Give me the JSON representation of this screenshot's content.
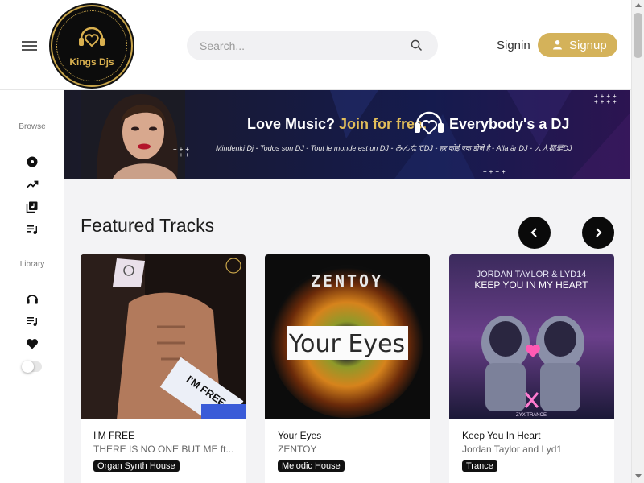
{
  "header": {
    "logo_text": "Kings Djs",
    "search_placeholder": "Search...",
    "signin_label": "Signin",
    "signup_label": "Signup"
  },
  "sidebar": {
    "browse_label": "Browse",
    "library_label": "Library",
    "browse_icons": [
      "disc-icon",
      "trending-icon",
      "library-music-icon",
      "playlist-icon"
    ],
    "library_icons": [
      "headphones-icon",
      "queue-music-icon",
      "heart-icon"
    ]
  },
  "banner": {
    "title_part1": "Love Music? ",
    "title_accent": "Join for free.",
    "title_part2": "Everybody's a DJ",
    "subtitle": "Mindenki Dj - Todos son DJ - Tout le monde est un DJ - みんなでDJ - हर कोई एक डीजे है - Alla är DJ - 人人都是DJ"
  },
  "featured": {
    "title": "Featured Tracks",
    "tracks": [
      {
        "title": "I'M FREE",
        "artist": "THERE IS NO ONE BUT ME ft...",
        "genre": "Organ Synth House",
        "art_text": "I'M FREE"
      },
      {
        "title": "Your Eyes",
        "artist": "ZENTOY",
        "genre": "Melodic House",
        "art_text": "Your Eyes",
        "art_brand": "ZENTOY"
      },
      {
        "title": "Keep You In Heart",
        "artist": "Jordan Taylor and Lyd1",
        "genre": "Trance",
        "art_line1": "JORDAN TAYLOR & LYD14",
        "art_line2": "KEEP YOU IN MY HEART",
        "art_footer": "ZYX TRANCE"
      }
    ]
  },
  "colors": {
    "accent": "#d4b25a",
    "dark": "#0a0a0a"
  }
}
